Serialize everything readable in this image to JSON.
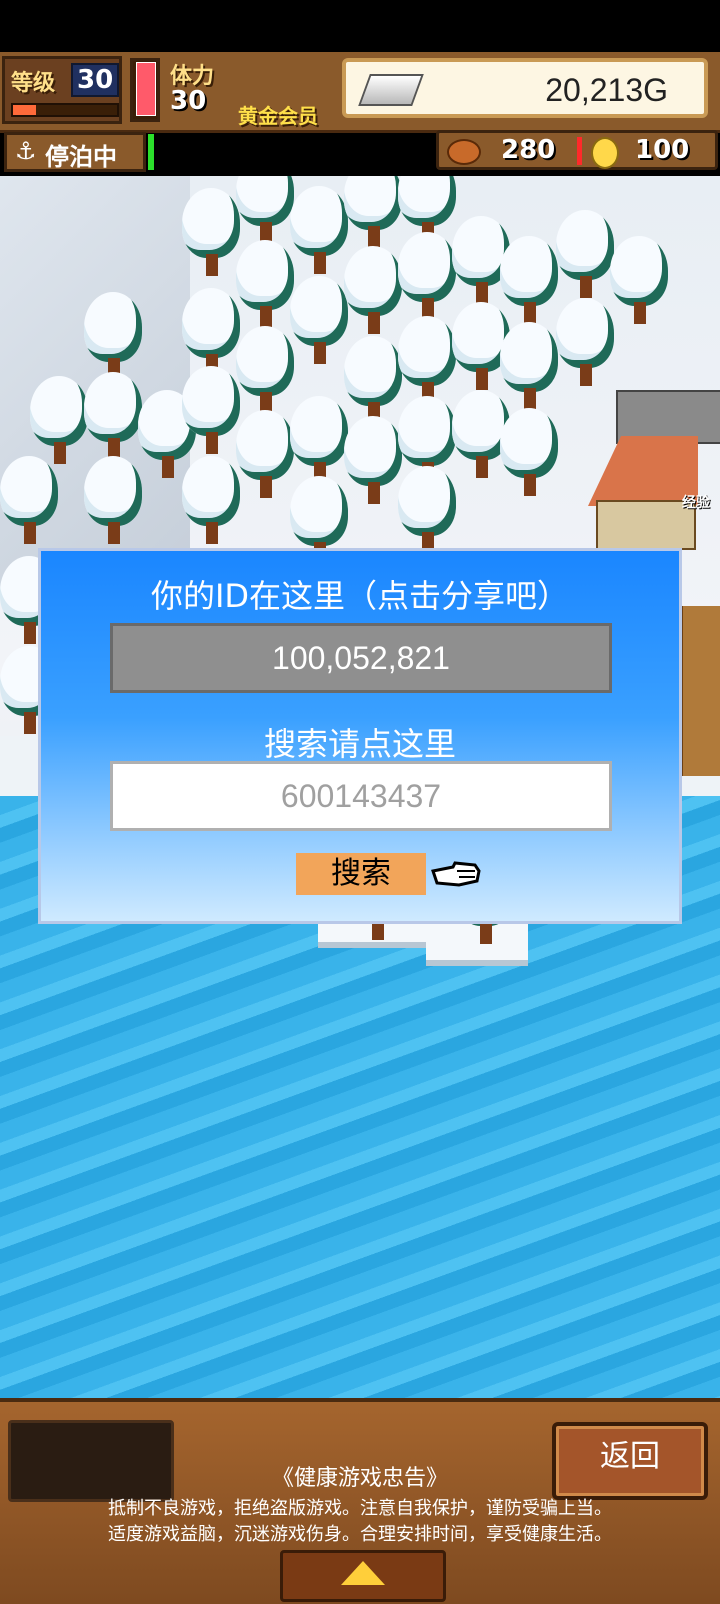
{
  "hud": {
    "level_label": "等级",
    "level_value": "30",
    "stamina_label": "体力",
    "stamina_value": "30",
    "member_label": "黄金会员",
    "gold_value": "20,213G",
    "anchor_status": "停泊中",
    "food_value": "280",
    "coin_value": "100"
  },
  "map": {
    "town_label": "经验"
  },
  "dialog": {
    "title": "你的ID在这里（点击分享吧）",
    "player_id": "100,052,821",
    "search_title": "搜索请点这里",
    "search_placeholder": "600143437",
    "search_button": "搜索"
  },
  "bottom": {
    "back_button": "返回",
    "notice_title": "《健康游戏忠告》",
    "notice_line1": "抵制不良游戏，拒绝盗版游戏。注意自我保护，谨防受骗上当。",
    "notice_line2": "适度游戏益脑，沉迷游戏伤身。合理安排时间，享受健康生活。"
  },
  "colors": {
    "dialog_top": "#1a86ff",
    "dialog_bottom": "#cfeaff",
    "search_button": "#f2a55a",
    "water": "#39b3ea",
    "hud_wood": "#8a5a2b"
  },
  "icons": [
    "anchor-icon",
    "silver-ingot-icon",
    "food-icon",
    "coin-icon",
    "pointing-hand-icon",
    "expand-arrow-icon"
  ]
}
